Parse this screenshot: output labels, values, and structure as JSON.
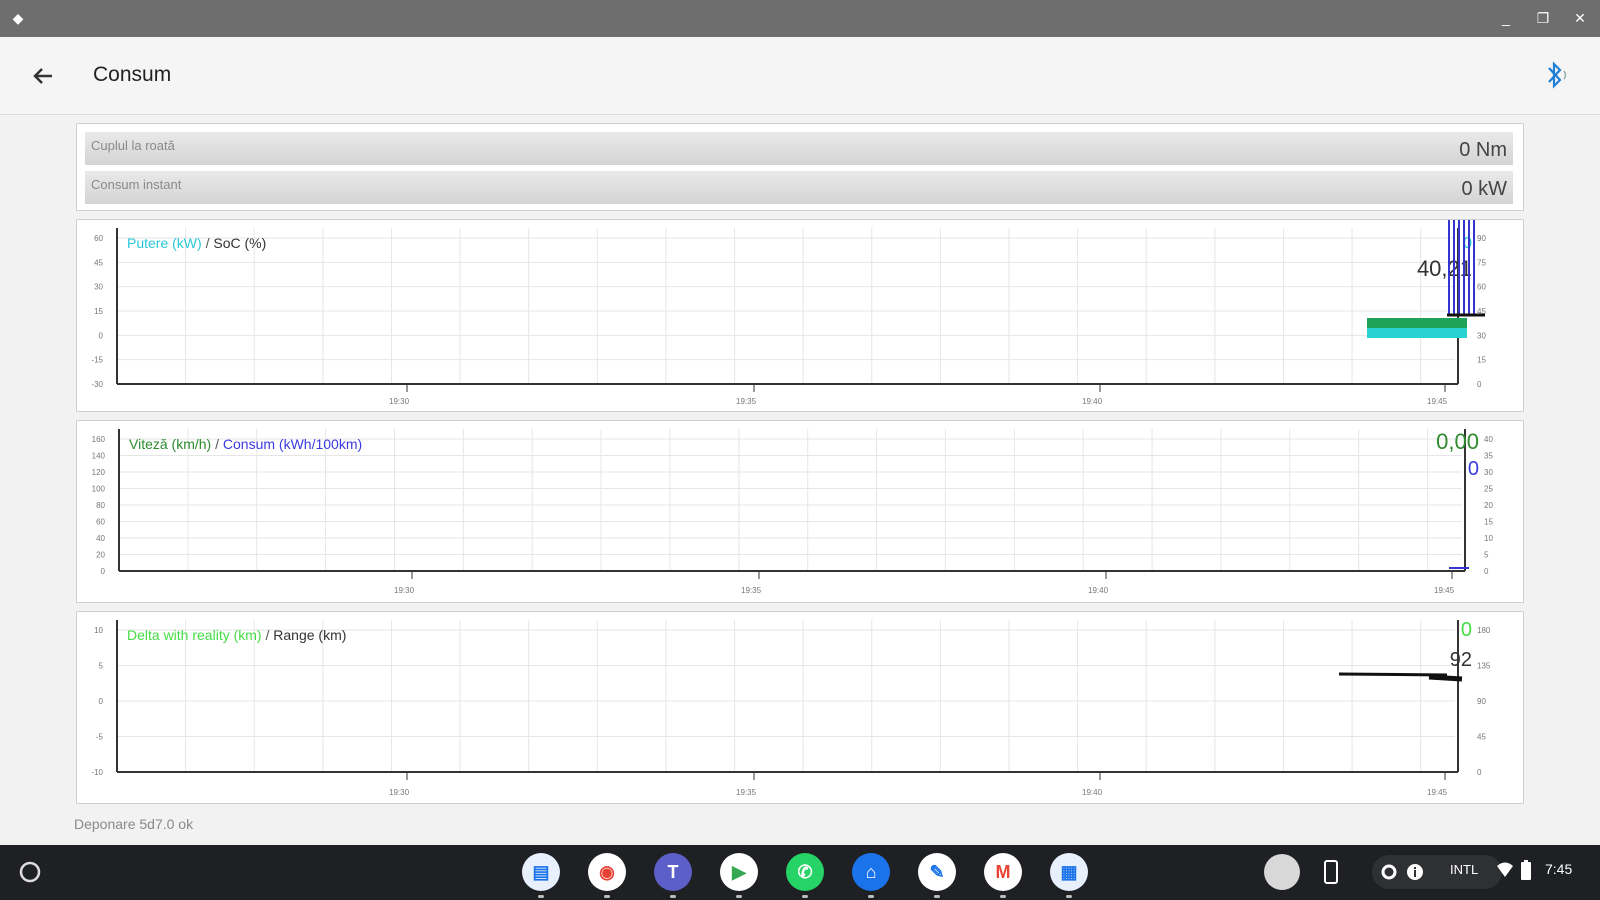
{
  "app": {
    "title": "Consum"
  },
  "info_rows": [
    {
      "label": "Cuplul la roată",
      "value": "0 Nm"
    },
    {
      "label": "Consum instant",
      "value": "0 kW"
    }
  ],
  "charts": [
    {
      "legend_a": "Putere (kW)",
      "legend_sep": " / ",
      "legend_b": "SoC (%)",
      "color_a": "#29c7d8",
      "color_b": "#333333",
      "readout_a": "0",
      "readout_b": "40,21",
      "left_ticks": [
        "60",
        "45",
        "30",
        "15",
        "0",
        "-15",
        "-30"
      ],
      "right_ticks": [
        "90",
        "75",
        "60",
        "45",
        "30",
        "15",
        "0"
      ],
      "x_ticks": [
        "19:30",
        "19:35",
        "19:40",
        "19:45"
      ]
    },
    {
      "legend_a": "Viteză (km/h)",
      "legend_sep": " / ",
      "legend_b": "Consum (kWh/100km)",
      "color_a": "#2e8b2e",
      "color_b": "#3b3be0",
      "readout_a": "0,00",
      "readout_b": "0",
      "left_ticks": [
        "160",
        "140",
        "120",
        "100",
        "80",
        "60",
        "40",
        "20",
        "0"
      ],
      "right_ticks": [
        "40",
        "35",
        "30",
        "25",
        "20",
        "15",
        "10",
        "5",
        "0"
      ],
      "x_ticks": [
        "19:30",
        "19:35",
        "19:40",
        "19:45"
      ]
    },
    {
      "legend_a": "Delta with reality (km)",
      "legend_sep": " / ",
      "legend_b": "Range (km)",
      "color_a": "#44dd44",
      "color_b": "#333333",
      "readout_a": "0",
      "readout_b": "92",
      "left_ticks": [
        "10",
        "5",
        "0",
        "-5",
        "-10"
      ],
      "right_ticks": [
        "180",
        "135",
        "90",
        "45",
        "0"
      ],
      "x_ticks": [
        "19:30",
        "19:35",
        "19:40",
        "19:45"
      ]
    }
  ],
  "status": "Deponare 5d7.0 ok",
  "shelf": {
    "apps": [
      {
        "name": "files-icon"
      },
      {
        "name": "chrome-icon"
      },
      {
        "name": "teams-icon"
      },
      {
        "name": "play-store-icon"
      },
      {
        "name": "whatsapp-icon"
      },
      {
        "name": "home-icon"
      },
      {
        "name": "chat-icon"
      },
      {
        "name": "gmail-icon"
      },
      {
        "name": "app-icon"
      }
    ],
    "ime": "INTL",
    "time": "7:45"
  },
  "colors": {
    "titlebar": "#6e6e6e",
    "shelf": "#1f2023",
    "green_bar": "#1fa35a",
    "cyan_bar": "#2ad1d1",
    "blue_lines": "#3434d0"
  }
}
